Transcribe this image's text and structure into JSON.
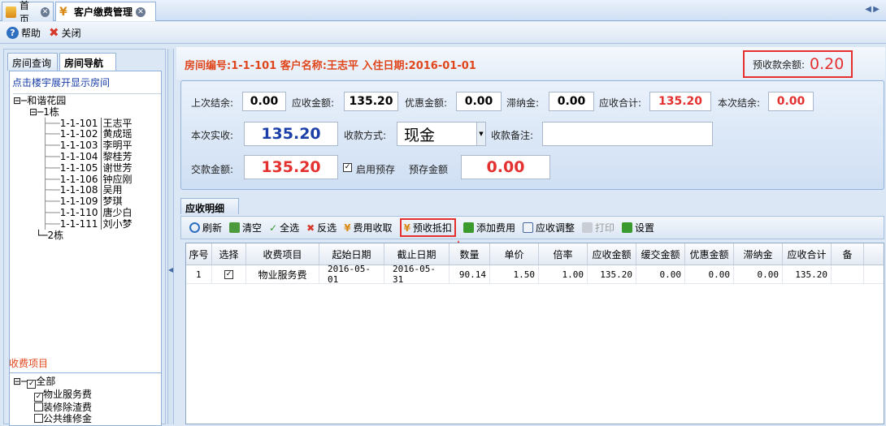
{
  "tabs": [
    {
      "label": "首页"
    },
    {
      "label": "客户缴费管理"
    }
  ],
  "toolbar": {
    "help": "帮助",
    "close": "关闭"
  },
  "left": {
    "tabs": [
      "房间查询",
      "房间导航"
    ],
    "hint": "点击楼宇展开显示房间",
    "tree": {
      "root": "和谐花园",
      "building1": "1栋",
      "rooms": [
        {
          "code": "1-1-101",
          "name": "王志平"
        },
        {
          "code": "1-1-102",
          "name": "黄成瑶"
        },
        {
          "code": "1-1-103",
          "name": "李明平"
        },
        {
          "code": "1-1-104",
          "name": "黎桂芳"
        },
        {
          "code": "1-1-105",
          "name": "谢世芳"
        },
        {
          "code": "1-1-106",
          "name": "钟应刚"
        },
        {
          "code": "1-1-108",
          "name": "吴用"
        },
        {
          "code": "1-1-109",
          "name": "梦琪"
        },
        {
          "code": "1-1-110",
          "name": "唐少白"
        },
        {
          "code": "1-1-111",
          "name": "刘小梦"
        }
      ],
      "building2": "2栋"
    },
    "fee_title": "收费项目",
    "fee_items": [
      "全部",
      "物业服务费",
      "装修除渣费",
      "公共维修金"
    ]
  },
  "header": {
    "room_info": "房间编号:1-1-101 客户名称:王志平 入住日期:2016-01-01",
    "balance_label": "预收款余额:",
    "balance_value": "0.20"
  },
  "form": {
    "last_balance_label": "上次结余:",
    "last_balance": "0.00",
    "receivable_label": "应收金额:",
    "receivable": "135.20",
    "discount_label": "优惠金额:",
    "discount": "0.00",
    "late_fee_label": "滞纳金:",
    "late_fee": "0.00",
    "total_label": "应收合计:",
    "total": "135.20",
    "this_balance_label": "本次结余:",
    "this_balance": "0.00",
    "actual_label": "本次实收:",
    "actual": "135.20",
    "method_label": "收款方式:",
    "method": "现金",
    "note_label": "收款备注:",
    "note": "",
    "paid_label": "交款金额:",
    "paid": "135.20",
    "prepay_enable_label": "启用预存",
    "prepay_label": "预存金额",
    "prepay": "0.00"
  },
  "detail": {
    "tab": "应收明细",
    "toolbar": [
      "刷新",
      "清空",
      "全选",
      "反选",
      "费用收取",
      "预收抵扣",
      "添加费用",
      "应收调整",
      "打印",
      "设置"
    ],
    "columns": [
      "序号",
      "选择",
      "收费项目",
      "起始日期",
      "截止日期",
      "数量",
      "单价",
      "倍率",
      "应收金额",
      "缓交金额",
      "优惠金额",
      "滞纳金",
      "应收合计",
      "备"
    ],
    "rows": [
      [
        "1",
        "",
        "物业服务费",
        "2016-05-01",
        "2016-05-31",
        "90.14",
        "1.50",
        "1.00",
        "135.20",
        "0.00",
        "0.00",
        "0.00",
        "135.20",
        ""
      ]
    ]
  },
  "colors": {
    "accent": "#e0461c",
    "red": "#e53030",
    "blue": "#1a3fa8"
  }
}
